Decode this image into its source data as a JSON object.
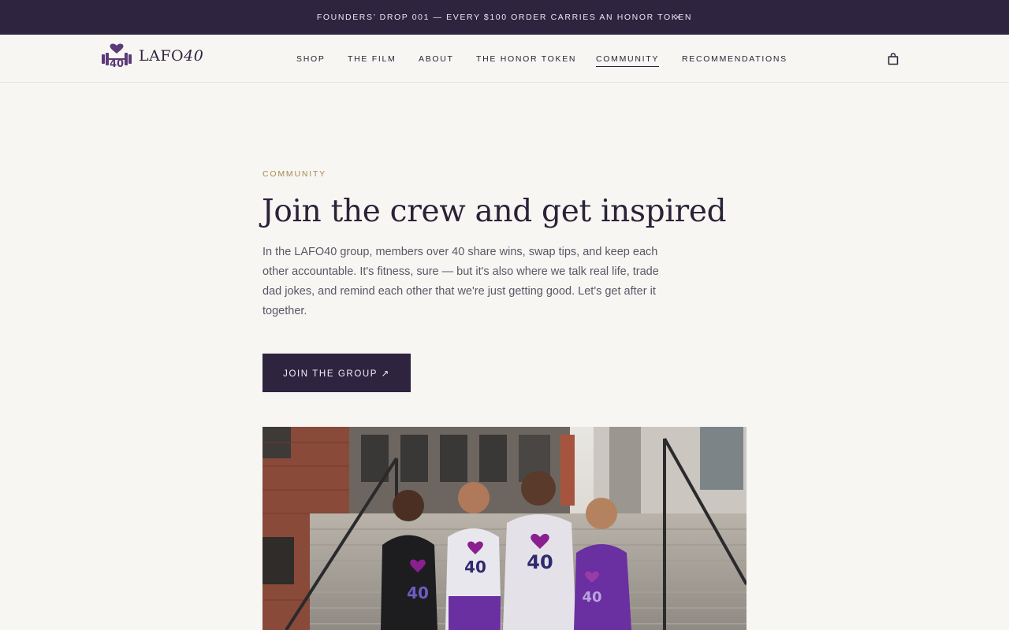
{
  "announcement": {
    "text": "FOUNDERS’ DROP 001 — EVERY $100 ORDER CARRIES AN HONOR TOKEN",
    "close": "×"
  },
  "brand": {
    "name_main": "LAFO",
    "name_num": "40",
    "logo_icon": "heart-barbell-40-icon"
  },
  "nav": [
    {
      "label": "SHOP"
    },
    {
      "label": "THE FILM"
    },
    {
      "label": "ABOUT"
    },
    {
      "label": "THE HONOR TOKEN"
    },
    {
      "label": "COMMUNITY",
      "active": true
    },
    {
      "label": "RECOMMENDATIONS"
    }
  ],
  "cart": {
    "icon": "shopping-bag-icon"
  },
  "hero": {
    "eyebrow": "COMMUNITY",
    "title": "Join the crew and get inspired",
    "body": "In the LAFO40 group, members over 40 share wins, swap tips, and keep each other accountable. It's fitness, sure — but it's also where we talk real life, trade dad jokes, and remind each other that we're just getting good. Let's get after it together.",
    "cta_label": "JOIN THE GROUP ↗"
  },
  "colors": {
    "accent": "#2e2440",
    "eyebrow": "#a58a4e",
    "background": "#f8f6f3",
    "shirt_purple": "#6a2fa0",
    "heart": "#8a1f8f"
  }
}
